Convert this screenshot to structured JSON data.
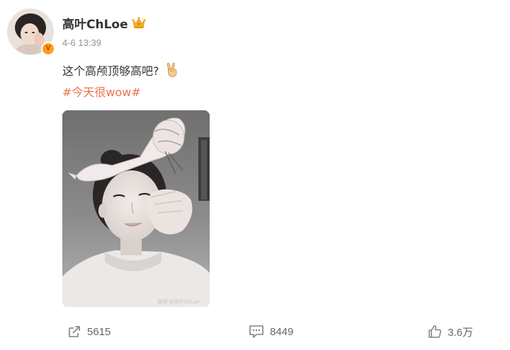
{
  "post": {
    "author": {
      "name": "高叶ChLoe",
      "verified_badge_letter": "V",
      "badge_color": "#f7a21b",
      "member_icon": "crown-icon"
    },
    "timestamp": "4-6 13:39",
    "text": "这个高颅顶够高吧?",
    "emoji": "victory-hand-icon",
    "hashtag": "#今天很wow#",
    "hashtag_color": "#eb7350",
    "image": {
      "description_icon": "selfie-photo",
      "watermark": "微博 @高叶ChLoe"
    },
    "actions": {
      "repost_count": "5615",
      "comment_count": "8449",
      "like_count": "3.6万"
    }
  }
}
